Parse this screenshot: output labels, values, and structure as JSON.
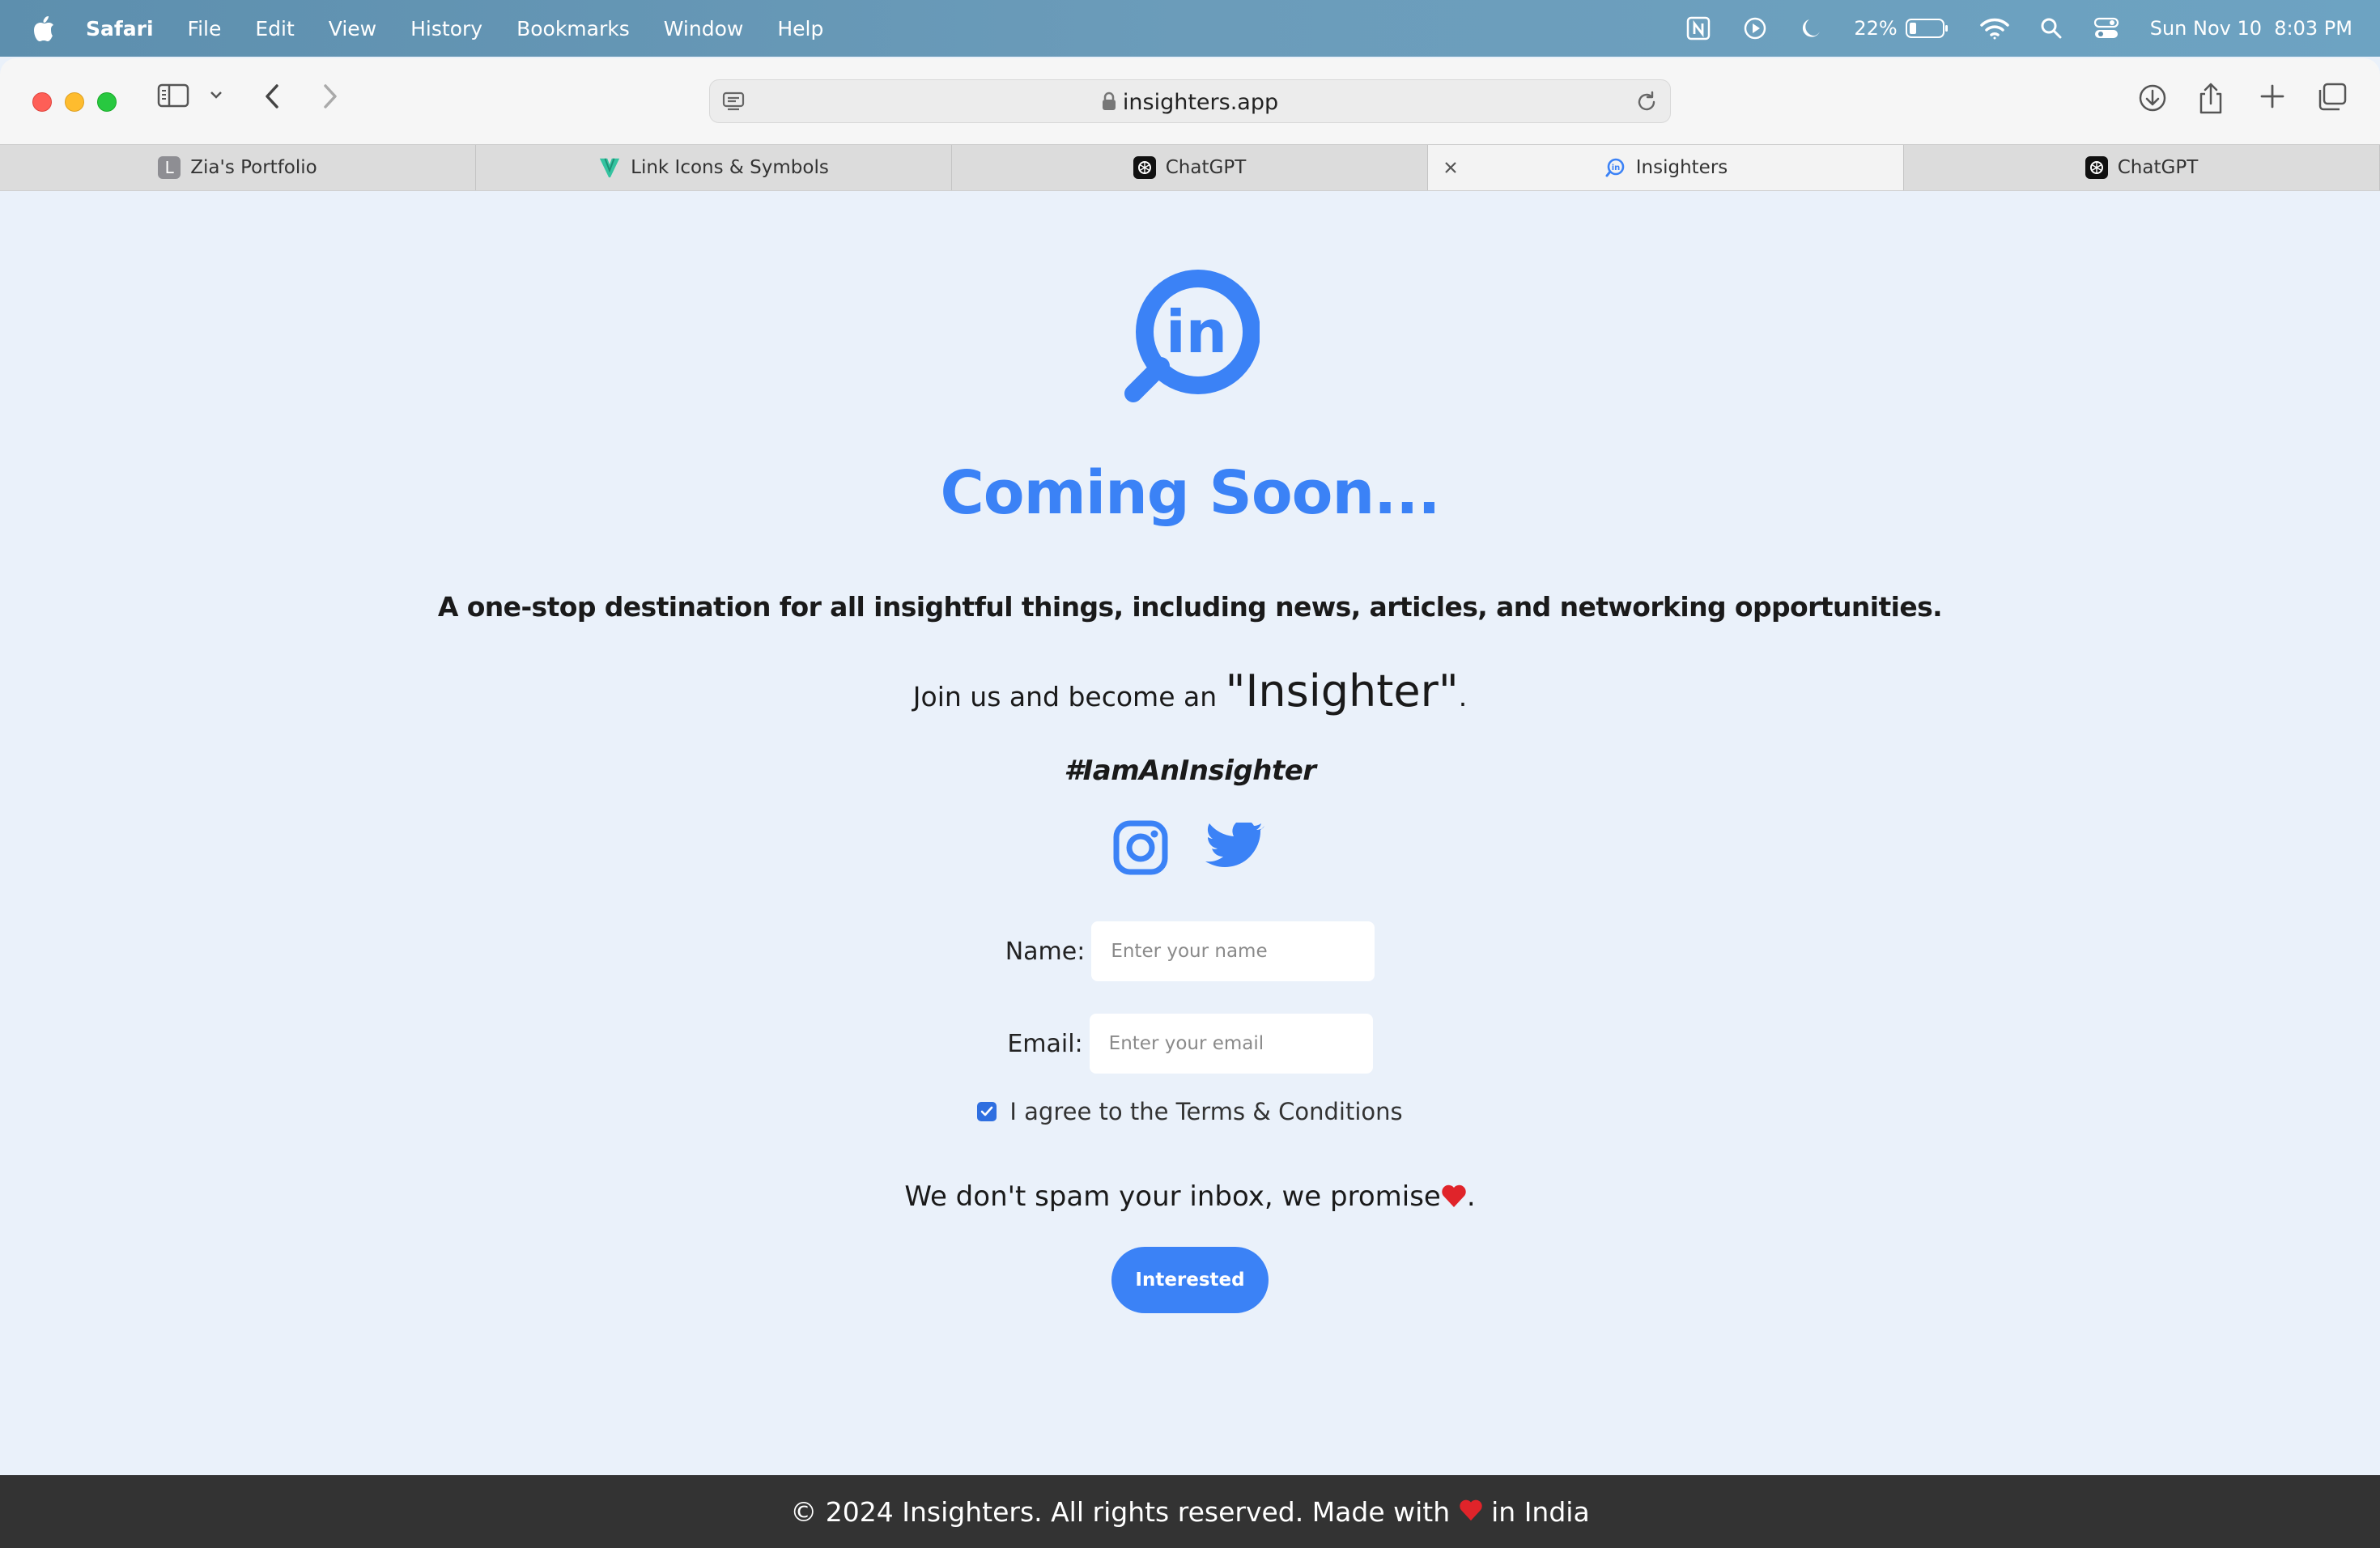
{
  "menubar": {
    "app": "Safari",
    "items": [
      "File",
      "Edit",
      "View",
      "History",
      "Bookmarks",
      "Window",
      "Help"
    ],
    "battery": "22%",
    "battery_level": 0.22,
    "datetime": "Sun Nov 10  8:03 PM"
  },
  "browser": {
    "url": "insighters.app"
  },
  "tabs": [
    {
      "title": "Zia's Portfolio",
      "icon": "letter-l-icon",
      "letter": "L"
    },
    {
      "title": "Link Icons & Symbols",
      "icon": "v-logo-icon"
    },
    {
      "title": "ChatGPT",
      "icon": "chatgpt-icon"
    },
    {
      "title": "Insighters",
      "icon": "insighters-icon",
      "active": true
    },
    {
      "title": "ChatGPT",
      "icon": "chatgpt-icon"
    }
  ],
  "page": {
    "title": "Coming Soon...",
    "tagline": "A one-stop destination for all insightful things, including news, articles, and networking opportunities.",
    "join_prefix": "Join us and become an ",
    "join_highlight": "\"Insighter\"",
    "join_suffix": ".",
    "hashtag": "#IamAnInsighter",
    "name_label": "Name:",
    "name_placeholder": "Enter your name",
    "email_label": "Email:",
    "email_placeholder": "Enter your email",
    "terms_label": "I agree to the Terms & Conditions",
    "terms_checked": true,
    "spam_text": "We don't spam your inbox, we promise",
    "spam_suffix": ".",
    "button_label": "Interested",
    "accent_color": "#3b82f6"
  },
  "footer": {
    "prefix": "© 2024 Insighters. All rights reserved. Made with ",
    "suffix": " in India"
  }
}
